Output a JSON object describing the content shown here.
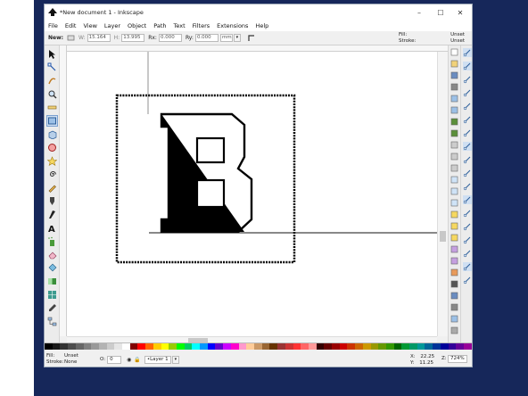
{
  "window": {
    "title": "*New document 1 - Inkscape",
    "controls": {
      "minimize": "–",
      "maximize": "☐",
      "close": "✕"
    }
  },
  "menu": [
    "File",
    "Edit",
    "View",
    "Layer",
    "Object",
    "Path",
    "Text",
    "Filters",
    "Extensions",
    "Help"
  ],
  "controls_bar": {
    "new_label": "New:",
    "w_label": "W:",
    "w_value": "15.164",
    "h_label": "H:",
    "h_value": "13.995",
    "rx_label": "Rx:",
    "rx_value": "0.000",
    "ry_label": "Ry:",
    "ry_value": "0.000",
    "unit": "mm"
  },
  "fill_stroke_indicator": {
    "fill_label": "Fill:",
    "fill_value": "Unset",
    "stroke_label": "Stroke:",
    "stroke_value": "Unset"
  },
  "tools": [
    "selector-tool-icon",
    "node-tool-icon",
    "tweak-tool-icon",
    "zoom-tool-icon",
    "measure-tool-icon",
    "rectangle-tool-icon",
    "3d-box-tool-icon",
    "ellipse-tool-icon",
    "star-tool-icon",
    "spiral-tool-icon",
    "pencil-tool-icon",
    "pen-tool-icon",
    "calligraphy-tool-icon",
    "text-tool-icon",
    "spray-tool-icon",
    "eraser-tool-icon",
    "paint-bucket-tool-icon",
    "gradient-tool-icon",
    "mesh-tool-icon",
    "dropper-tool-icon",
    "connector-tool-icon"
  ],
  "palette": [
    "#000000",
    "#1a1a1a",
    "#333333",
    "#4d4d4d",
    "#666666",
    "#808080",
    "#999999",
    "#b3b3b3",
    "#cccccc",
    "#e6e6e6",
    "#ffffff",
    "#800000",
    "#ff0000",
    "#ff6600",
    "#ffcc00",
    "#ffff00",
    "#99cc00",
    "#00ff00",
    "#00cc66",
    "#00ffff",
    "#0099ff",
    "#0000ff",
    "#6600cc",
    "#cc00ff",
    "#ff00cc",
    "#ff99cc",
    "#ffcc99",
    "#cc9966",
    "#996633",
    "#663300",
    "#993333",
    "#cc3333",
    "#ff3333",
    "#ff6666",
    "#ff9999",
    "#330000",
    "#660000",
    "#990000",
    "#cc0000",
    "#cc3300",
    "#cc6600",
    "#cc9900",
    "#999900",
    "#669900",
    "#339900",
    "#006600",
    "#009933",
    "#009966",
    "#009999",
    "#006699",
    "#003399",
    "#000099",
    "#330099",
    "#660099",
    "#990099"
  ],
  "status": {
    "fill_label": "Fill:",
    "fill_value": "Unset",
    "stroke_label": "Stroke:",
    "stroke_value": "None",
    "opacity_label": "O:",
    "opacity_value": "0",
    "layer": "•Layer 1",
    "x_label": "X:",
    "x_value": "22.25",
    "y_label": "Y:",
    "y_value": "11.25",
    "zoom_label": "Z:",
    "zoom_value": "724%"
  }
}
